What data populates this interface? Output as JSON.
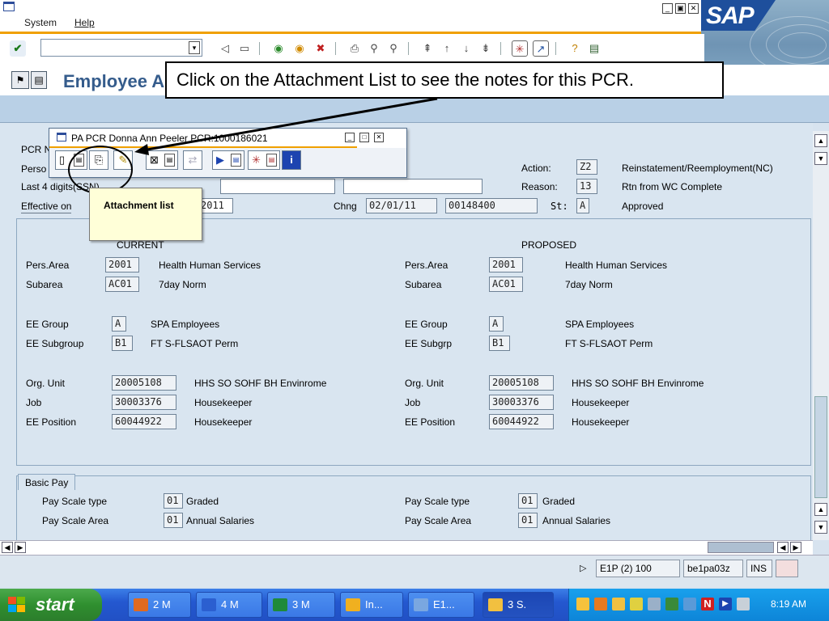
{
  "menu": {
    "system": "System",
    "help": "Help"
  },
  "window_title": "Employee A",
  "callout": "Click on the Attachment List to see the notes for this PCR.",
  "popup": {
    "title": "PA PCR Donna Ann Peeler PCR:1000186021"
  },
  "tooltip": "Attachment list",
  "header": {
    "pcr_label": "PCR N",
    "pers_label": "Perso",
    "last4_label": "Last 4 digits(SSN)",
    "effective_label": "Effective on",
    "effective_value": "2011",
    "chng_label": "Chng",
    "chng_date": "02/01/11",
    "chng_id": "00148400",
    "st_label": "St:",
    "st_value": "A",
    "st_text": "Approved",
    "action_label": "Action:",
    "action_code": "Z2",
    "action_text": "Reinstatement/Reemployment(NC)",
    "reason_label": "Reason:",
    "reason_code": "13",
    "reason_text": "Rtn from WC Complete"
  },
  "current": {
    "heading": "CURRENT",
    "pers_area": {
      "label": "Pers.Area",
      "code": "2001",
      "text": "Health Human Services"
    },
    "subarea": {
      "label": "Subarea",
      "code": "AC01",
      "text": "7day Norm"
    },
    "ee_group": {
      "label": "EE Group",
      "code": "A",
      "text": "SPA Employees"
    },
    "ee_subgroup": {
      "label": "EE Subgroup",
      "code": "B1",
      "text": "FT S-FLSAOT Perm"
    },
    "org_unit": {
      "label": "Org. Unit",
      "code": "20005108",
      "text": "HHS SO SOHF BH  Envinrome"
    },
    "job": {
      "label": "Job",
      "code": "30003376",
      "text": "Housekeeper"
    },
    "ee_position": {
      "label": "EE Position",
      "code": "60044922",
      "text": "Housekeeper"
    }
  },
  "proposed": {
    "heading": "PROPOSED",
    "pers_area": {
      "label": "Pers.Area",
      "code": "2001",
      "text": "Health Human Services"
    },
    "subarea": {
      "label": "Subarea",
      "code": "AC01",
      "text": "7day Norm"
    },
    "ee_group": {
      "label": "EE Group",
      "code": "A",
      "text": "SPA Employees"
    },
    "ee_subgroup": {
      "label": "EE Subgrp",
      "code": "B1",
      "text": "FT S-FLSAOT Perm"
    },
    "org_unit": {
      "label": "Org. Unit",
      "code": "20005108",
      "text": "HHS SO SOHF BH  Envinrome"
    },
    "job": {
      "label": "Job",
      "code": "30003376",
      "text": "Housekeeper"
    },
    "ee_position": {
      "label": "EE Position",
      "code": "60044922",
      "text": "Housekeeper"
    }
  },
  "basic_pay": {
    "tab": "Basic Pay",
    "scale_type_label": "Pay Scale type",
    "scale_type_code": "01",
    "scale_type_text": "Graded",
    "scale_area_label": "Pay Scale Area",
    "scale_area_code": "01",
    "scale_area_text": "Annual Salaries",
    "proposed_scale_type_label": "Pay Scale type",
    "proposed_scale_type_code": "01",
    "proposed_scale_type_text": "Graded",
    "proposed_scale_area_label": "Pay Scale Area",
    "proposed_scale_area_code": "01",
    "proposed_scale_area_text": "Annual Salaries"
  },
  "status": {
    "system": "E1P (2) 100",
    "server": "be1pa03z",
    "mode": "INS"
  },
  "taskbar": {
    "start": "start",
    "tasks": [
      "2 M",
      "4 M",
      "3 M",
      "In...",
      "E1...",
      "3 S."
    ],
    "clock": "8:19 AM"
  },
  "colors": {
    "sap_blue": "#1e4f9c",
    "orange": "#f0a000",
    "title_blue": "#355c8c",
    "tooltip_bg": "#ffffd8"
  }
}
